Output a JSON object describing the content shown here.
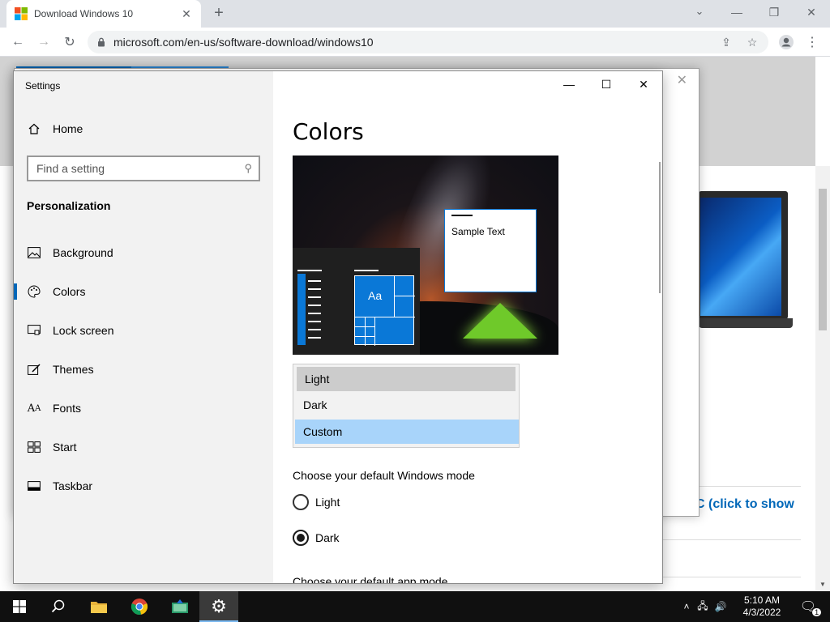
{
  "browser": {
    "tab_title": "Download Windows 10",
    "url": "microsoft.com/en-us/software-download/windows10"
  },
  "webpage": {
    "link_text": "C (click to show"
  },
  "settings": {
    "app_title": "Settings",
    "home_label": "Home",
    "search_placeholder": "Find a setting",
    "section": "Personalization",
    "nav": [
      {
        "label": "Background",
        "icon": "picture-icon"
      },
      {
        "label": "Colors",
        "icon": "palette-icon",
        "active": true
      },
      {
        "label": "Lock screen",
        "icon": "lock-screen-icon"
      },
      {
        "label": "Themes",
        "icon": "brush-icon"
      },
      {
        "label": "Fonts",
        "icon": "font-icon"
      },
      {
        "label": "Start",
        "icon": "start-icon"
      },
      {
        "label": "Taskbar",
        "icon": "taskbar-icon"
      }
    ],
    "page_title": "Colors",
    "preview_sample_text": "Sample Text",
    "preview_tile_text": "Aa",
    "color_options": [
      "Light",
      "Dark",
      "Custom"
    ],
    "color_option_hover": "Light",
    "color_option_selected": "Custom",
    "windows_mode_label": "Choose your default Windows mode",
    "windows_mode_options": [
      "Light",
      "Dark"
    ],
    "windows_mode_selected": "Dark",
    "app_mode_label": "Choose your default app mode"
  },
  "taskbar": {
    "time": "5:10 AM",
    "date": "4/3/2022",
    "notification_count": "1"
  },
  "colors": {
    "accent": "#0067b8",
    "selected_option": "#a8d4fa",
    "taskbar": "#101010"
  }
}
